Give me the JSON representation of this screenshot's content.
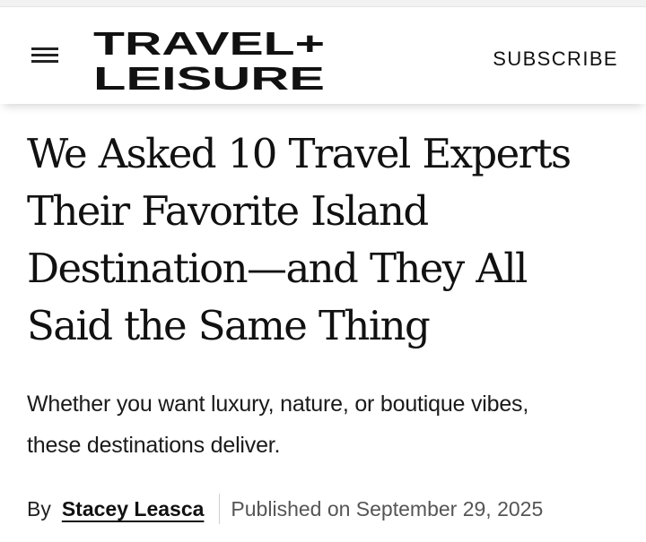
{
  "header": {
    "logo_line1": "TRAVEL+",
    "logo_line2": "LEISURE",
    "menu_icon": "hamburger-menu-icon",
    "subscribe_label": "SUBSCRIBE"
  },
  "article": {
    "headline_lines": [
      "We Asked 10 Travel Experts",
      "Their Favorite Island",
      "Destination—and They All",
      "Said the Same Thing"
    ],
    "dek_lines": [
      "Whether you want luxury, nature, or boutique vibes,",
      "these destinations deliver."
    ],
    "byline": {
      "prefix": "By",
      "author": "Stacey Leasca",
      "published": "Published on September 29, 2025"
    }
  },
  "colors": {
    "text": "#111111",
    "secondary_text": "#555555",
    "divider": "#cfcfcf",
    "background": "#ffffff"
  }
}
